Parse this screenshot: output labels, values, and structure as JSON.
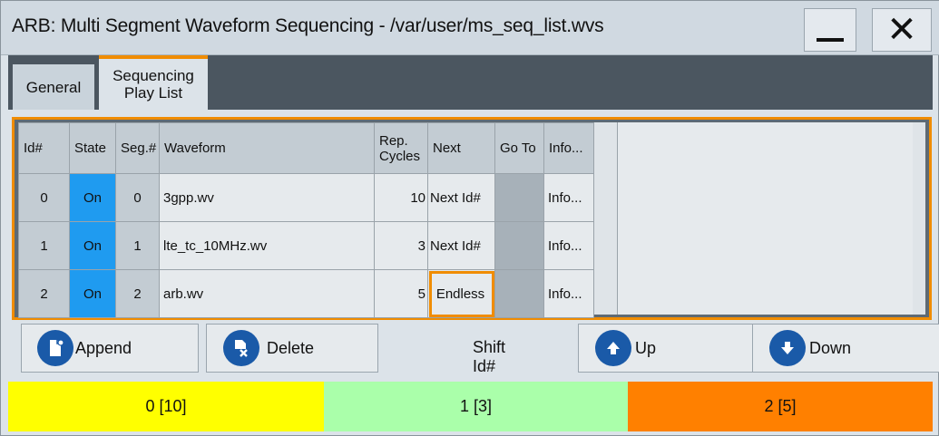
{
  "window": {
    "title": "ARB: Multi Segment Waveform Sequencing - /var/user/ms_seq_list.wvs"
  },
  "tabs": [
    {
      "label": "General",
      "active": false
    },
    {
      "label_line1": "Sequencing",
      "label_line2": "Play List",
      "active": true
    }
  ],
  "table": {
    "headers": {
      "id": "Id#",
      "state": "State",
      "seg": "Seg.#",
      "waveform": "Waveform",
      "rep_line1": "Rep.",
      "rep_line2": "Cycles",
      "next": "Next",
      "goto": "Go To",
      "info": "Info..."
    },
    "rows": [
      {
        "id": "0",
        "state": "On",
        "seg": "0",
        "waveform": "3gpp.wv",
        "rep": "10",
        "next": "Next Id#",
        "goto": "",
        "info": "Info..."
      },
      {
        "id": "1",
        "state": "On",
        "seg": "1",
        "waveform": "lte_tc_10MHz.wv",
        "rep": "3",
        "next": "Next Id#",
        "goto": "",
        "info": "Info..."
      },
      {
        "id": "2",
        "state": "On",
        "seg": "2",
        "waveform": "arb.wv",
        "rep": "5",
        "next": "Endless",
        "goto": "",
        "info": "Info..."
      }
    ]
  },
  "buttons": {
    "append": "Append",
    "delete": "Delete",
    "shift_label": "Shift Id#",
    "up": "Up",
    "down": "Down"
  },
  "segments": [
    {
      "label": "0 [10]",
      "color": "#ffff00"
    },
    {
      "label": "1 [3]",
      "color": "#aaffaa"
    },
    {
      "label": "2 [5]",
      "color": "#ff8000"
    }
  ],
  "colors": {
    "accent": "#f08c00",
    "state_on": "#1f9bf0",
    "icon_blue": "#1a5aa8"
  },
  "icons": {
    "append": "append-document-icon",
    "delete": "delete-document-icon",
    "up": "arrow-up-icon",
    "down": "arrow-down-icon",
    "minimize": "minimize-icon",
    "close": "close-icon"
  }
}
